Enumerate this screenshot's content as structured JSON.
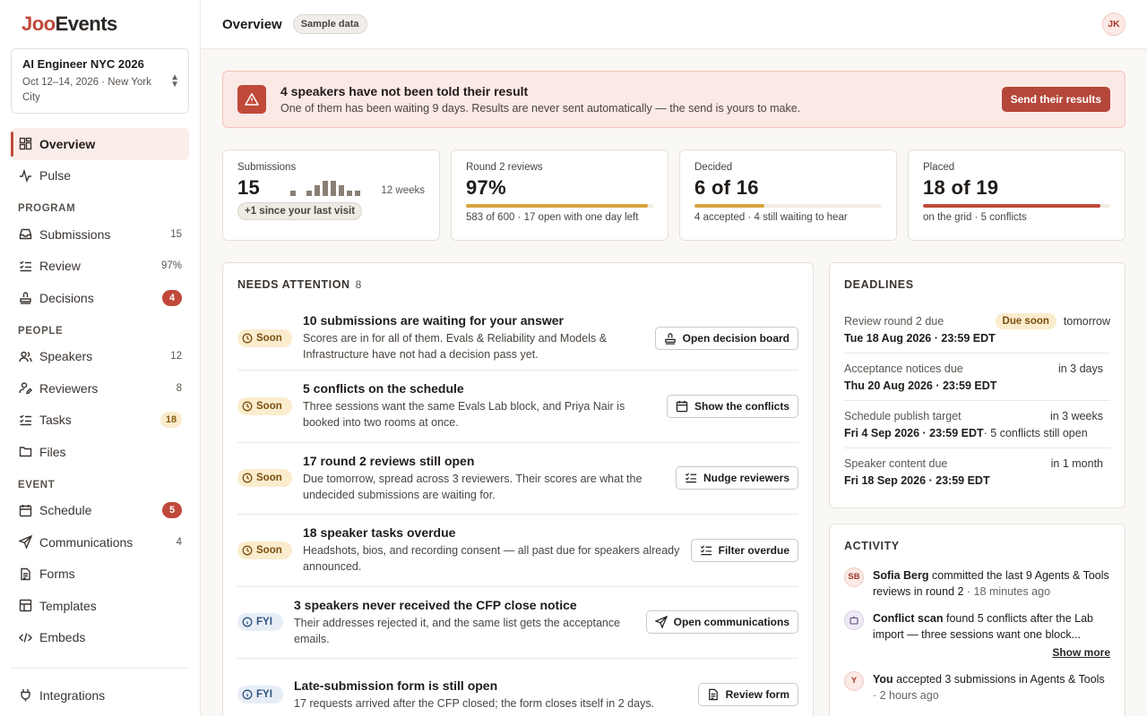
{
  "brand": {
    "part1": "Joo",
    "part2": "Events"
  },
  "event": {
    "name": "AI Engineer NYC 2026",
    "meta": "Oct 12–14, 2026 · New York City"
  },
  "nav": {
    "overview": "Overview",
    "pulse": "Pulse",
    "program_label": "PROGRAM",
    "submissions": {
      "label": "Submissions",
      "count": "15"
    },
    "review": {
      "label": "Review",
      "count": "97%"
    },
    "decisions": {
      "label": "Decisions",
      "count": "4"
    },
    "people_label": "PEOPLE",
    "speakers": {
      "label": "Speakers",
      "count": "12"
    },
    "reviewers": {
      "label": "Reviewers",
      "count": "8"
    },
    "tasks": {
      "label": "Tasks",
      "count": "18"
    },
    "files": "Files",
    "event_label": "EVENT",
    "schedule": {
      "label": "Schedule",
      "count": "5"
    },
    "communications": {
      "label": "Communications",
      "count": "4"
    },
    "forms": "Forms",
    "templates": "Templates",
    "embeds": "Embeds",
    "integrations": "Integrations"
  },
  "topbar": {
    "title": "Overview",
    "chip": "Sample data",
    "avatar": "JK"
  },
  "alert": {
    "title": "4 speakers have not been told their result",
    "body": "One of them has been waiting 9 days. Results are never sent automatically — the send is yours to make.",
    "button": "Send their results"
  },
  "stats": {
    "submissions": {
      "label": "Submissions",
      "value": "15",
      "spark_label": "12 weeks",
      "pill": "+1 since your last visit",
      "spark": [
        0,
        0,
        2,
        0,
        2,
        5,
        7,
        7,
        5,
        2,
        2,
        0
      ]
    },
    "round2": {
      "label": "Round 2 reviews",
      "value": "97%",
      "progress": 0.97,
      "sub": "583 of 600 · 17 open with one day left"
    },
    "decided": {
      "label": "Decided",
      "value": "6 of 16",
      "progress": 0.375,
      "sub": "4 accepted · 4 still waiting to hear"
    },
    "placed": {
      "label": "Placed",
      "value": "18 of 19",
      "progress": 0.947,
      "sub": "on the grid · 5 conflicts"
    }
  },
  "attention": {
    "title": "NEEDS ATTENTION",
    "count": "8",
    "items": [
      {
        "tag": "Soon",
        "title": "10 submissions are waiting for your answer",
        "desc": "Scores are in for all of them. Evals & Reliability and Models & Infrastructure have not had a decision pass yet.",
        "button": "Open decision board"
      },
      {
        "tag": "Soon",
        "title": "5 conflicts on the schedule",
        "desc": "Three sessions want the same Evals Lab block, and Priya Nair is booked into two rooms at once.",
        "button": "Show the conflicts"
      },
      {
        "tag": "Soon",
        "title": "17 round 2 reviews still open",
        "desc": "Due tomorrow, spread across 3 reviewers. Their scores are what the undecided submissions are waiting for.",
        "button": "Nudge reviewers"
      },
      {
        "tag": "Soon",
        "title": "18 speaker tasks overdue",
        "desc": "Headshots, bios, and recording consent — all past due for speakers already announced.",
        "button": "Filter overdue"
      },
      {
        "tag": "FYI",
        "title": "3 speakers never received the CFP close notice",
        "desc": "Their addresses rejected it, and the same list gets the acceptance emails.",
        "button": "Open communications"
      },
      {
        "tag": "FYI",
        "title": "Late-submission form is still open",
        "desc": "17 requests arrived after the CFP closed; the form closes itself in 2 days.",
        "button": "Review form"
      }
    ]
  },
  "deadlines": {
    "title": "DEADLINES",
    "items": [
      {
        "name": "Review round 2 due",
        "pill": "Due soon",
        "rel": "tomorrow",
        "date": "Tue 18 Aug 2026 · 23:59 EDT",
        "extra": ""
      },
      {
        "name": "Acceptance notices due",
        "pill": "",
        "rel": "in 3 days",
        "date": "Thu 20 Aug 2026 · 23:59 EDT",
        "extra": ""
      },
      {
        "name": "Schedule publish target",
        "pill": "",
        "rel": "in 3 weeks",
        "date": "Fri 4 Sep 2026 · 23:59 EDT",
        "extra": "· 5 conflicts still open"
      },
      {
        "name": "Speaker content due",
        "pill": "",
        "rel": "in 1 month",
        "date": "Fri 18 Sep 2026 · 23:59 EDT",
        "extra": ""
      }
    ]
  },
  "activity": {
    "title": "ACTIVITY",
    "items": [
      {
        "avatar": "SB",
        "actor": "Sofia Berg",
        "text": " committed the last 9 Agents & Tools reviews in round 2",
        "time": " · 18 minutes ago"
      },
      {
        "avatar": "",
        "actor": "Conflict scan",
        "text": " found 5 conflicts after the Lab import — three sessions want one block...",
        "time": ""
      },
      {
        "avatar": "Y",
        "actor": "You",
        "text": " accepted 3 submissions in Agents & Tools",
        "time": " · 2 hours ago"
      }
    ],
    "show_more": "Show more"
  },
  "colors": {
    "accent": "#c0493a",
    "amber": "#d9a23e",
    "soon_bg": "#faeccd",
    "fyi_bg": "#e8eef6"
  }
}
